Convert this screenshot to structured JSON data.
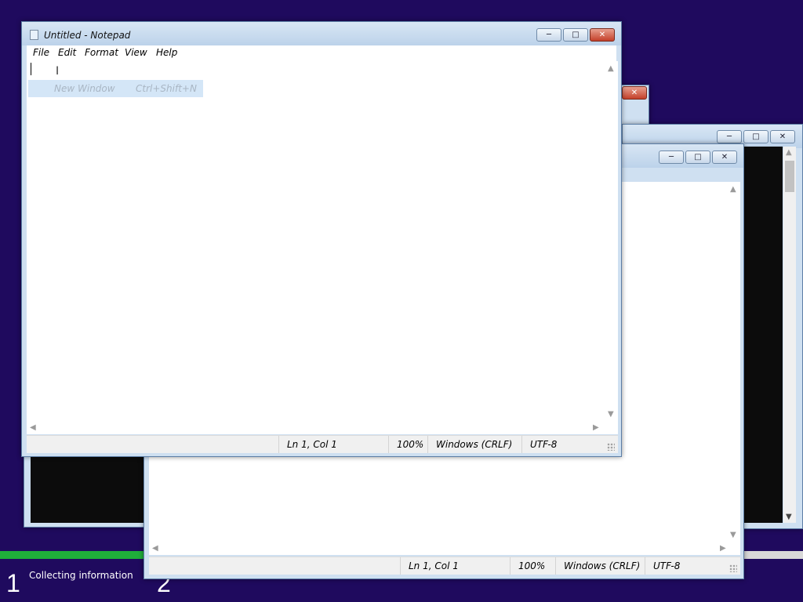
{
  "desktop": {
    "background": "#1f0a5e",
    "setup_step1_number": "1",
    "setup_step1_label": "Collecting information",
    "setup_step2_number": "2",
    "progress_fraction": 0.18
  },
  "front_window": {
    "title": "Untitled - Notepad",
    "menu": [
      "File",
      "Edit",
      "Format",
      "View",
      "Help"
    ],
    "menu_item_label": "New Window",
    "menu_item_shortcut": "Ctrl+Shift+N",
    "status": {
      "position": "Ln 1, Col 1",
      "zoom": "100%",
      "line_ending": "Windows (CRLF)",
      "encoding": "UTF-8"
    }
  },
  "back_window": {
    "status": {
      "position": "Ln 1, Col 1",
      "zoom": "100%",
      "line_ending": "Windows (CRLF)",
      "encoding": "UTF-8"
    }
  },
  "icons": {
    "minimize": "─",
    "maximize": "□",
    "close": "✕",
    "arrow_up": "▲",
    "arrow_down": "▼",
    "arrow_left": "◀",
    "arrow_right": "▶"
  }
}
